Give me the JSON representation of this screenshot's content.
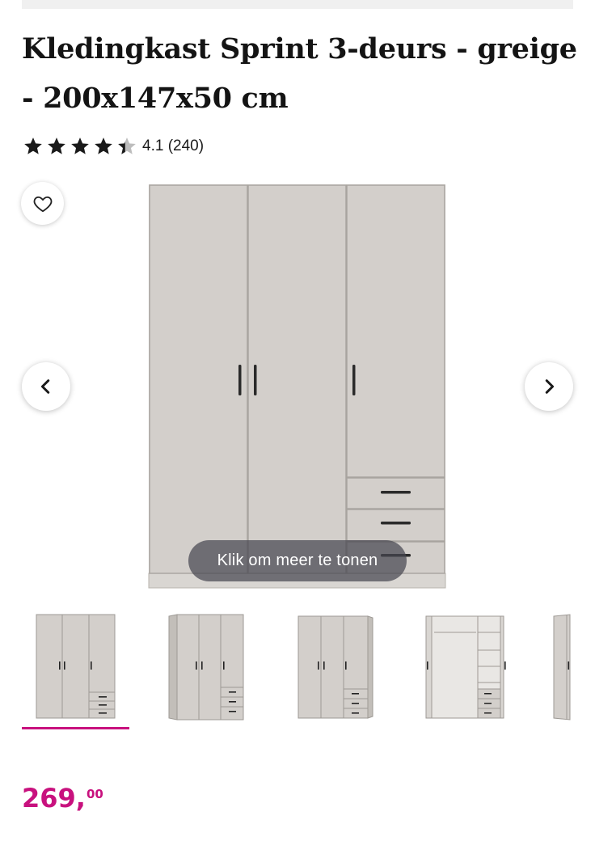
{
  "product": {
    "title": "Kledingkast Sprint 3-deurs - greige - 200x147x50 cm",
    "rating": {
      "value": 4.1,
      "stars_filled": 4,
      "stars_total": 5,
      "text": "4.1 (240)"
    },
    "price": {
      "main": "269,",
      "cents": "00"
    }
  },
  "gallery": {
    "overlay_text": "Klik om meer te tonen",
    "thumbnails": [
      {
        "label": "front-view",
        "active": true
      },
      {
        "label": "angled-view",
        "active": false
      },
      {
        "label": "angled-view-2",
        "active": false
      },
      {
        "label": "open-view",
        "active": false
      },
      {
        "label": "side-view",
        "active": false
      }
    ]
  },
  "colors": {
    "accent": "#c8117e",
    "wardrobe": "#d3cfcb",
    "star": "#1a1a1a",
    "star_empty": "#bdbdbd"
  },
  "icons": {
    "favorite": "heart-outline-icon",
    "prev": "chevron-left-icon",
    "next": "chevron-right-icon",
    "rating": "star-icon"
  }
}
